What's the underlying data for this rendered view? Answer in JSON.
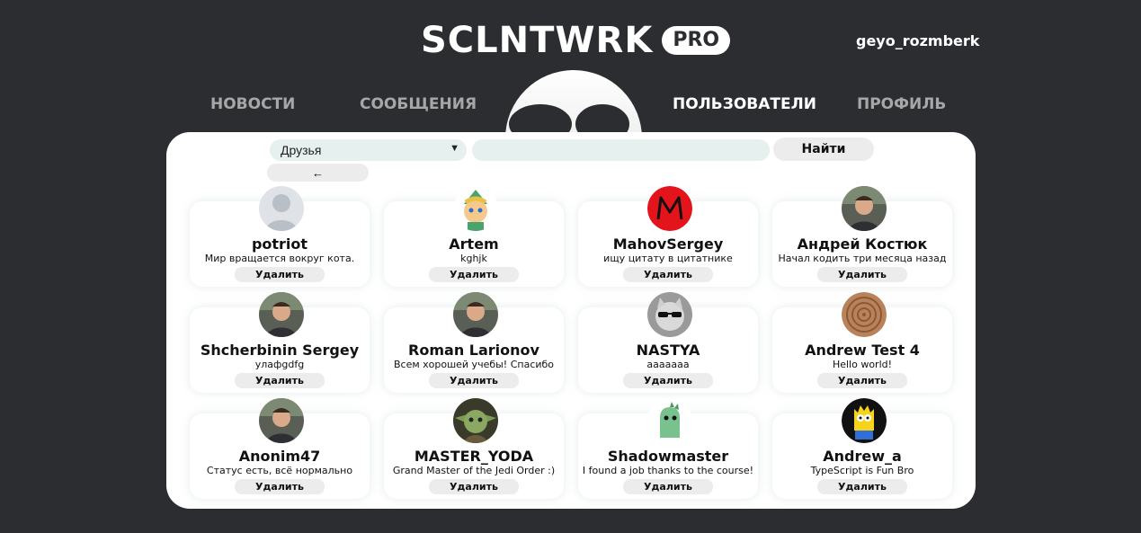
{
  "header": {
    "logo_text": "SCLNTWRK",
    "logo_badge": "PRO",
    "username": "geyo_rozmberk"
  },
  "nav": {
    "news": "НОВОСТИ",
    "messages": "СООБЩЕНИЯ",
    "users": "ПОЛЬЗОВАТЕЛИ",
    "profile": "ПРОФИЛЬ",
    "active": "users"
  },
  "filters": {
    "select_value": "Друзья",
    "search_value": "",
    "find_label": "Найти",
    "back_label": "←"
  },
  "users": [
    {
      "name": "potriot",
      "status": "Мир вращается вокруг кота.",
      "action": "Удалить",
      "avatar": "default-user-icon"
    },
    {
      "name": "Artem",
      "status": "kghjk",
      "action": "Удалить",
      "avatar": "cartoon-avatar"
    },
    {
      "name": "MahovSergey",
      "status": "ищу цитату в цитатнике",
      "action": "Удалить",
      "avatar": "red-m-logo"
    },
    {
      "name": "Андрей Костюк",
      "status": "Начал кодить три месяца назад",
      "action": "Удалить",
      "avatar": "photo-avatar"
    },
    {
      "name": "Shcherbinin Sergey",
      "status": "улафgdfg",
      "action": "Удалить",
      "avatar": "photo-avatar"
    },
    {
      "name": "Roman Larionov",
      "status": "Всем хорошей учебы! Спасибо",
      "action": "Удалить",
      "avatar": "photo-avatar"
    },
    {
      "name": "NASTYA",
      "status": "ааааааа",
      "action": "Удалить",
      "avatar": "cat-sunglasses-avatar"
    },
    {
      "name": "Andrew Test 4",
      "status": "Hello world!",
      "action": "Удалить",
      "avatar": "wood-avatar"
    },
    {
      "name": "Anonim47",
      "status": "Статус есть, всё нормально",
      "action": "Удалить",
      "avatar": "photo-avatar"
    },
    {
      "name": "MASTER_YODA",
      "status": "Grand Master of the Jedi Order :)",
      "action": "Удалить",
      "avatar": "yoda-avatar"
    },
    {
      "name": "Shadowmaster",
      "status": "I found a job thanks to the course!",
      "action": "Удалить",
      "avatar": "dino-avatar"
    },
    {
      "name": "Andrew_a",
      "status": "TypeScript is Fun Bro",
      "action": "Удалить",
      "avatar": "bart-avatar"
    }
  ],
  "colors": {
    "background": "#2b2d31",
    "panel": "#ffffff",
    "input_bg": "#e6f0ef",
    "button_bg": "#ececec"
  }
}
